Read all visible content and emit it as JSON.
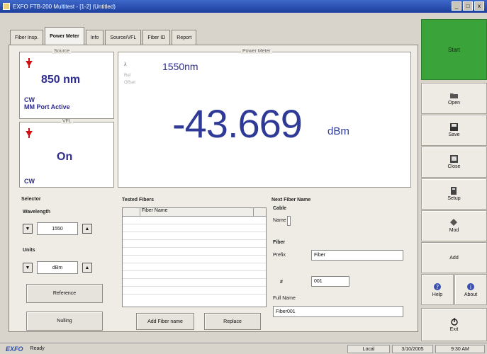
{
  "titlebar": {
    "title": "EXFO FTB-200 Multitest - [1-2] (Untitled)",
    "minimize": "_",
    "maximize": "□",
    "close": "x"
  },
  "tabs": [
    "Fiber Insp.",
    "Power Meter",
    "Info",
    "Source/VFL",
    "Fiber ID",
    "Report"
  ],
  "source": {
    "title": "Source",
    "wavelength": "850 nm",
    "mode1": "CW",
    "mode2": "MM Port Active"
  },
  "vfl": {
    "title": "VFL",
    "state": "On",
    "mode": "CW"
  },
  "power_meter": {
    "title": "Power Meter",
    "lambda": "λ",
    "wavelength": "1550nm",
    "ref": "Ref",
    "offset": "Offset",
    "reading": "-43.669",
    "unit": "dBm"
  },
  "selector": {
    "title": "Selector",
    "wavelength_label": "Wavelength",
    "wavelength_value": "1550",
    "units_label": "Units",
    "units_value": "dBm",
    "reference_button": "Reference",
    "nulling_button": "Nulling"
  },
  "tested_fibers": {
    "title": "Tested Fibers",
    "column": "Fiber Name",
    "add_button": "Add Fiber name",
    "replace_button": "Replace"
  },
  "next_fiber": {
    "title": "Next Fiber Name",
    "cable_label": "Cable",
    "cable_name_label": "Name",
    "fiber_label": "Fiber",
    "prefix_label": "Prefix",
    "prefix_value": "Fiber",
    "number_label": "#",
    "number_value": "001",
    "fullname_label": "Full Name",
    "fullname_value": "Fiber001"
  },
  "sidebar": {
    "start": "Start",
    "open": "Open",
    "save": "Save",
    "close": "Close",
    "setup": "Setup",
    "mod": "Mod",
    "add": "Add",
    "help": "Help",
    "about": "About",
    "exit": "Exit"
  },
  "statusbar": {
    "logo": "EXFO",
    "status": "Ready",
    "c1": "Local",
    "c2": "3/10/2005",
    "c3": "9:30 AM"
  },
  "colors": {
    "start_green": "#3aa33a",
    "reading_blue": "#2e3a96",
    "title_blue": "#1e3f9e"
  }
}
